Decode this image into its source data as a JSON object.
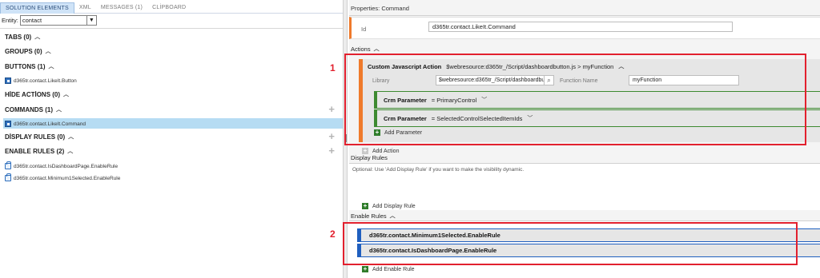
{
  "left": {
    "tabs": [
      {
        "label": "SOLUTION ELEMENTS",
        "active": true
      },
      {
        "label": "XML",
        "active": false
      },
      {
        "label": "MESSAGES (1)",
        "active": false
      },
      {
        "label": "CLİPBOARD",
        "active": false
      }
    ],
    "entity_label": "Entity:",
    "entity_value": "contact",
    "sections": {
      "tabs": "TABS (0)",
      "groups": "GROUPS (0)",
      "buttons": "BUTTONS (1)",
      "hide_actions": "HİDE ACTİONS (0)",
      "commands": "COMMANDS (1)",
      "display_rules": "DİSPLAY RULES (0)",
      "enable_rules": "ENABLE RULES (2)"
    },
    "items": {
      "button": "d365tr.contact.LikeIt.Button",
      "command": "d365tr.contact.LikeIt.Command",
      "enable_rule_1": "d365tr.contact.IsDashboardPage.EnableRule",
      "enable_rule_2": "d365tr.contact.Minimum1Selected.EnableRule"
    }
  },
  "right": {
    "title": "Properties: Command",
    "id_label": "Id",
    "id_value": "d365tr.contact.LikeIt.Command",
    "actions_label": "Actions",
    "action": {
      "type_label": "Custom Javascript Action",
      "summary": "$webresource:d365tr_/Script/dashboardbutton.js > myFunction",
      "library_label": "Library",
      "library_value": "$webresource:d365tr_/Script/dashboardbutton.js",
      "function_label": "Function Name",
      "function_value": "myFunction",
      "params": [
        {
          "label": "Crm Parameter",
          "value": "= PrimaryControl"
        },
        {
          "label": "Crm Parameter",
          "value": "= SelectedControlSelectedItemIds"
        }
      ],
      "add_param_label": "Add Parameter"
    },
    "add_action_label": "Add Action",
    "display_rules_label": "Display Rules",
    "display_rules_hint": "Optional: Use 'Add Display Rule' if you want to make the visibility dynamic.",
    "add_display_rule_label": "Add Display Rule",
    "enable_rules_label": "Enable Rules",
    "enable_rules": [
      "d365tr.contact.Minimum1Selected.EnableRule",
      "d365tr.contact.IsDashboardPage.EnableRule"
    ],
    "add_enable_rule_label": "Add Enable Rule"
  },
  "annotations": [
    "1",
    "2"
  ],
  "colors": {
    "command_accent": "#ef7a2b",
    "param_accent": "#3d8a30",
    "rule_accent": "#1f5fbf",
    "annotation_red": "#e2202e",
    "selected_row": "#b6dcf3"
  }
}
